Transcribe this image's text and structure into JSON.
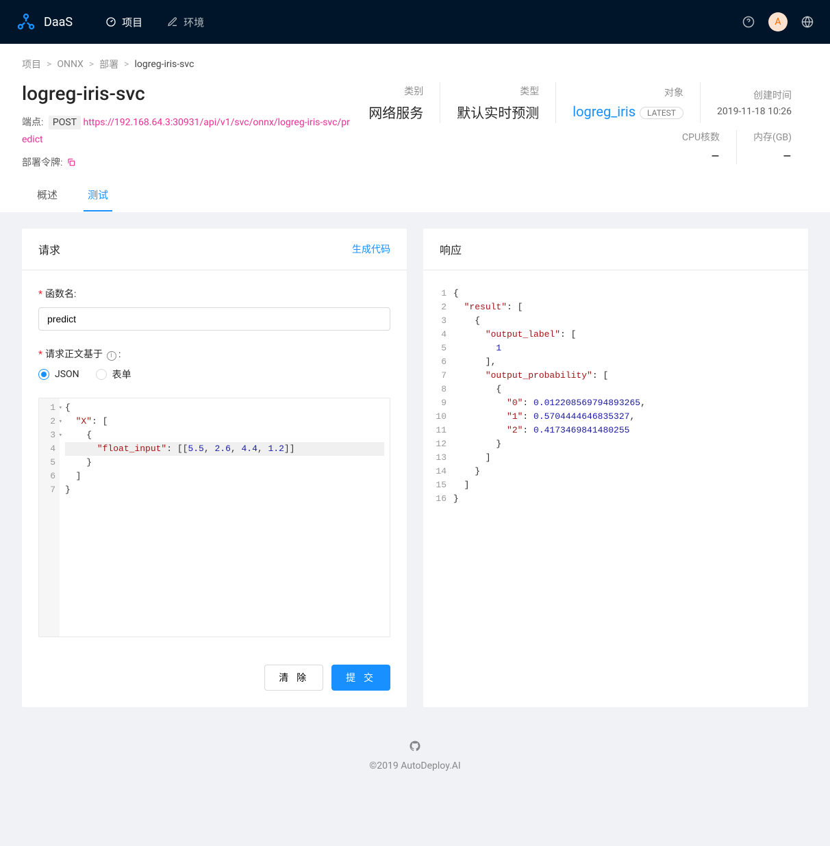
{
  "header": {
    "brand": "DaaS",
    "nav": {
      "projects": "项目",
      "envs": "环境"
    },
    "avatar": "A"
  },
  "breadcrumb": {
    "projects": "项目",
    "onnx": "ONNX",
    "deploy": "部署",
    "current": "logreg-iris-svc"
  },
  "page": {
    "title": "logreg-iris-svc",
    "endpoint_label": "端点:",
    "method": "POST",
    "url": "https://192.168.64.3:30931/api/v1/svc/onnx/logreg-iris-svc/predict",
    "token_label": "部署令牌:"
  },
  "meta": {
    "category_label": "类别",
    "category_value": "网络服务",
    "type_label": "类型",
    "type_value": "默认实时预测",
    "object_label": "对象",
    "object_link": "logreg_iris",
    "object_tag": "LATEST",
    "created_label": "创建时间",
    "created_value": "2019-11-18 10:26",
    "cpu_label": "CPU核数",
    "cpu_value": "–",
    "mem_label": "内存(GB)",
    "mem_value": "–"
  },
  "tabs": {
    "overview": "概述",
    "test": "测试"
  },
  "request": {
    "title": "请求",
    "gen_code": "生成代码",
    "func_label": "函数名:",
    "func_value": "predict",
    "body_label": "请求正文基于",
    "json": "JSON",
    "form": "表单",
    "code_key_x": "\"X\"",
    "code_key_fi": "\"float_input\"",
    "code_values": [
      "5.5",
      "2.6",
      "4.4",
      "1.2"
    ],
    "clear": "清 除",
    "submit": "提 交"
  },
  "response": {
    "title": "响应",
    "json": {
      "result": [
        {
          "output_label": [
            1
          ],
          "output_probability": [
            {
              "0": 0.012208569794893265,
              "1": 0.5704444646835327,
              "2": 0.4173469841480255
            }
          ]
        }
      ]
    }
  },
  "footer": {
    "copyright": "©2019 AutoDeploy.AI"
  }
}
